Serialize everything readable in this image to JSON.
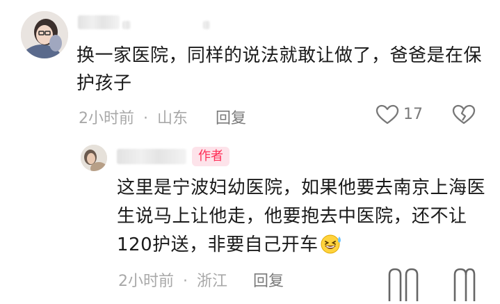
{
  "comments": [
    {
      "text": "换一家医院，同样的说法就敢让做了，爸爸是在保护孩子",
      "time": "2小时前",
      "separator": "·",
      "location": "山东",
      "reply_label": "回复",
      "like_count": "17",
      "icons": {
        "like": "heart-outline-icon",
        "dislike": "broken-heart-icon"
      }
    },
    {
      "author_badge": "作者",
      "text": "这里是宁波妇幼医院，如果他要去南京上海医生说马上让他走，他要抱去中医院，还不让120护送，非要自己开车",
      "emoji": "laughing-sweat-emoji",
      "time": "2小时前",
      "separator": "·",
      "location": "浙江",
      "reply_label": "回复"
    }
  ],
  "colors": {
    "author_badge_bg": "#fde3ea",
    "author_badge_text": "#fe2c55",
    "meta_text": "#a8a8a8"
  }
}
